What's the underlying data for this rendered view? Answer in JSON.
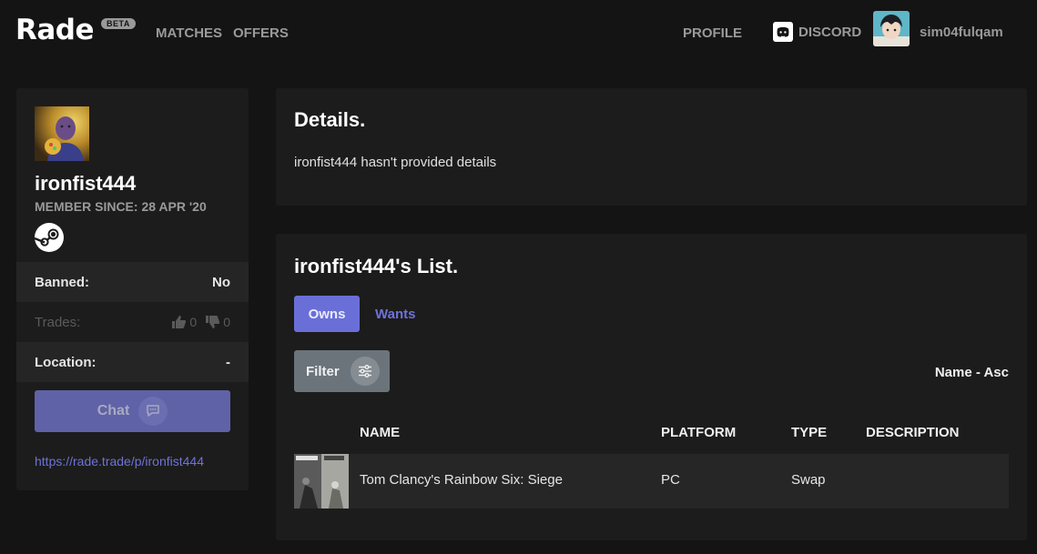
{
  "nav": {
    "logo": "Rade",
    "badge": "BETA",
    "matches": "MATCHES",
    "offers": "OFFERS",
    "profile": "PROFILE",
    "discord": "DISCORD",
    "username": "sim04fulqam"
  },
  "sidebar": {
    "username": "ironfist444",
    "member_since": "MEMBER SINCE: 28 APR '20",
    "banned_label": "Banned:",
    "banned_value": "No",
    "trades_label": "Trades:",
    "trades_up": "0",
    "trades_down": "0",
    "location_label": "Location:",
    "location_value": "-",
    "chat_label": "Chat",
    "profile_link": "https://rade.trade/p/ironfist444"
  },
  "details": {
    "title": "Details.",
    "text": "ironfist444 hasn't provided details"
  },
  "list": {
    "title": "ironfist444's List.",
    "tabs": {
      "owns": "Owns",
      "wants": "Wants"
    },
    "filter_label": "Filter",
    "sort_label": "Name - Asc",
    "columns": [
      "NAME",
      "PLATFORM",
      "TYPE",
      "DESCRIPTION"
    ],
    "rows": [
      {
        "name": "Tom Clancy's Rainbow Six: Siege",
        "platform": "PC",
        "type": "Swap",
        "description": ""
      }
    ]
  },
  "colors": {
    "background": "#141414",
    "card": "#1c1c1c",
    "accent": "#6a6fd8",
    "chat_button": "#5f62a6",
    "filter_button": "#6b747b",
    "muted_text": "#9a9a9a"
  },
  "icons": [
    "discord-icon",
    "steam-icon",
    "thumbs-up-icon",
    "thumbs-down-icon",
    "chat-bubble-icon",
    "sliders-icon"
  ]
}
